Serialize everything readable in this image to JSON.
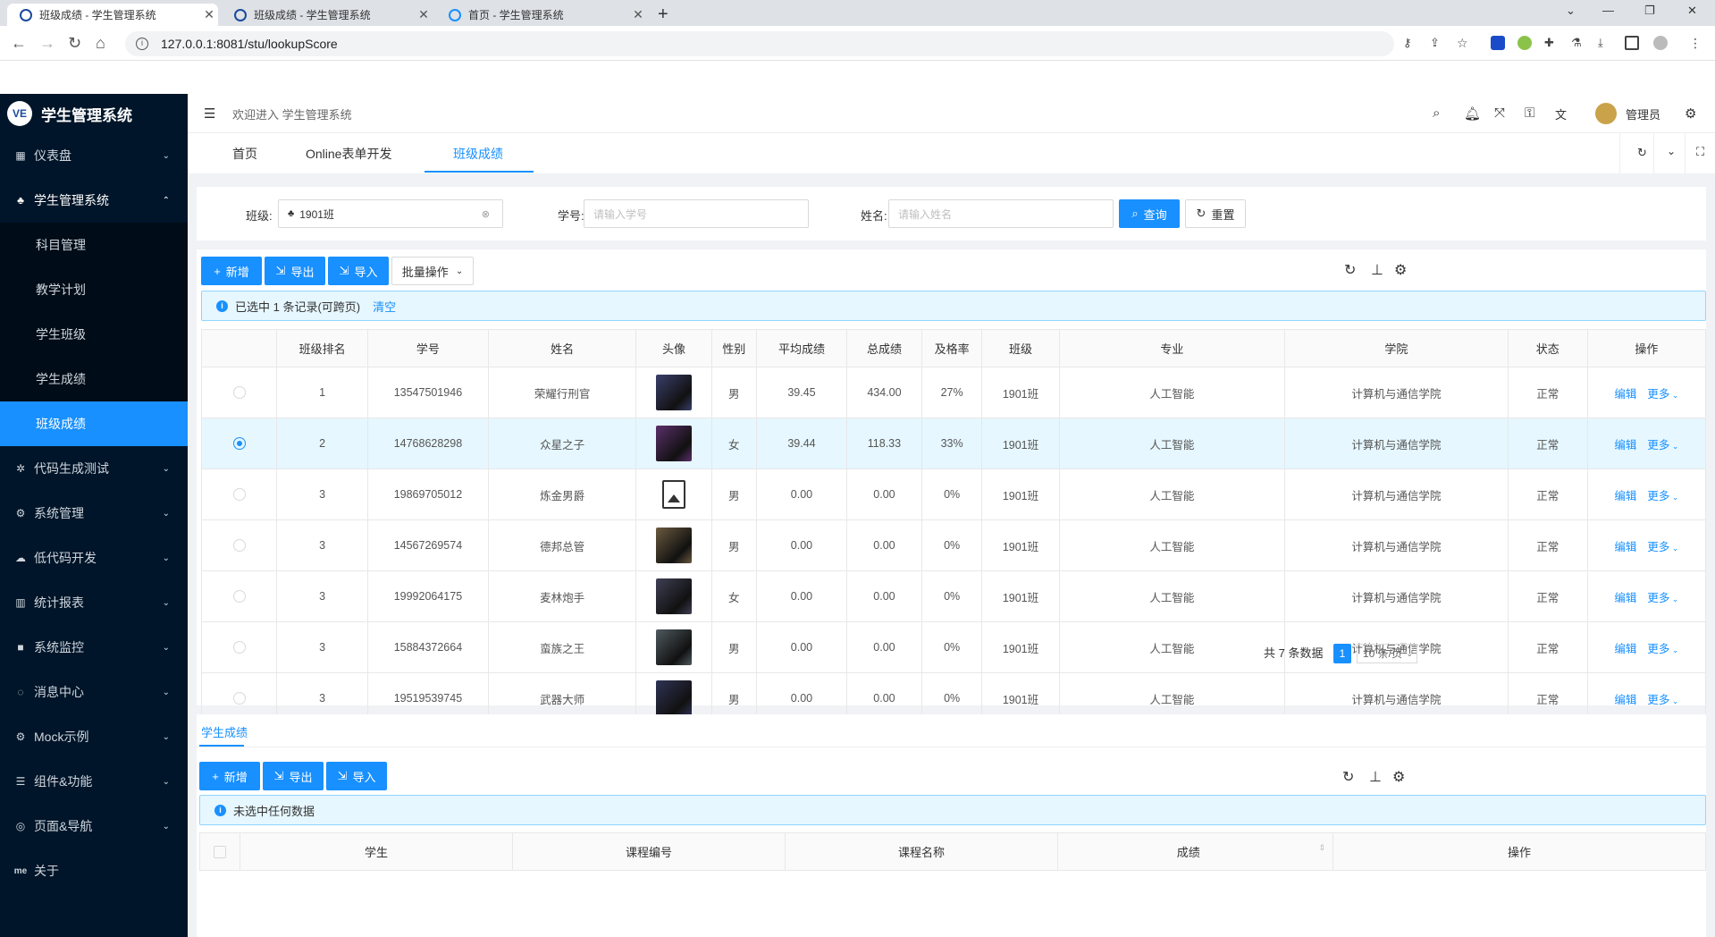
{
  "browser": {
    "tabs": [
      {
        "title": "班级成绩 - 学生管理系统"
      },
      {
        "title": "班级成绩 - 学生管理系统"
      },
      {
        "title": "首页 - 学生管理系统"
      }
    ],
    "url": "127.0.0.1:8081/stu/lookupScore"
  },
  "app": {
    "title": "学生管理系统",
    "welcome": "欢迎进入 学生管理系统",
    "user": "管理员"
  },
  "sidebar": {
    "items": [
      {
        "label": "仪表盘",
        "icon": "dashboard-icon"
      },
      {
        "label": "学生管理系统",
        "icon": "cluster-icon",
        "open": true
      },
      {
        "label": "代码生成测试",
        "icon": "bug-icon"
      },
      {
        "label": "系统管理",
        "icon": "setting-icon"
      },
      {
        "label": "低代码开发",
        "icon": "cloud-icon"
      },
      {
        "label": "统计报表",
        "icon": "bar-chart-icon"
      },
      {
        "label": "系统监控",
        "icon": "video-icon"
      },
      {
        "label": "消息中心",
        "icon": "message-icon"
      },
      {
        "label": "Mock示例",
        "icon": "setting-icon"
      },
      {
        "label": "组件&功能",
        "icon": "database-icon"
      },
      {
        "label": "页面&导航",
        "icon": "compass-icon"
      },
      {
        "label": "关于",
        "icon": "me-icon"
      }
    ],
    "subitems": [
      "科目管理",
      "教学计划",
      "学生班级",
      "学生成绩",
      "班级成绩"
    ]
  },
  "pagetabs": [
    "首页",
    "Online表单开发",
    "班级成绩"
  ],
  "search": {
    "class_label": "班级:",
    "class_value": "1901班",
    "sid_label": "学号:",
    "sid_placeholder": "请输入学号",
    "name_label": "姓名:",
    "name_placeholder": "请输入姓名",
    "query": "查询",
    "reset": "重置"
  },
  "toolbar": {
    "add": "新增",
    "export": "导出",
    "import": "导入",
    "batch": "批量操作"
  },
  "selection": {
    "text": "已选中 1 条记录(可跨页)",
    "clear": "清空"
  },
  "table": {
    "columns": [
      "班级排名",
      "学号",
      "姓名",
      "头像",
      "性别",
      "平均成绩",
      "总成绩",
      "及格率",
      "班级",
      "专业",
      "学院",
      "状态",
      "操作"
    ],
    "edit": "编辑",
    "more": "更多",
    "rows": [
      {
        "rank": "1",
        "sid": "13547501946",
        "name": "荣耀行刑官",
        "gender": "男",
        "avg": "39.45",
        "total": "434.00",
        "pass": "27%",
        "class": "1901班",
        "major": "人工智能",
        "college": "计算机与通信学院",
        "status": "正常",
        "selected": false,
        "avatar": "#3a3f6b"
      },
      {
        "rank": "2",
        "sid": "14768628298",
        "name": "众星之子",
        "gender": "女",
        "avg": "39.44",
        "total": "118.33",
        "pass": "33%",
        "class": "1901班",
        "major": "人工智能",
        "college": "计算机与通信学院",
        "status": "正常",
        "selected": true,
        "avatar": "#5a2f6b"
      },
      {
        "rank": "3",
        "sid": "19869705012",
        "name": "炼金男爵",
        "gender": "男",
        "avg": "0.00",
        "total": "0.00",
        "pass": "0%",
        "class": "1901班",
        "major": "人工智能",
        "college": "计算机与通信学院",
        "status": "正常",
        "selected": false,
        "avatar": "none"
      },
      {
        "rank": "3",
        "sid": "14567269574",
        "name": "德邦总管",
        "gender": "男",
        "avg": "0.00",
        "total": "0.00",
        "pass": "0%",
        "class": "1901班",
        "major": "人工智能",
        "college": "计算机与通信学院",
        "status": "正常",
        "selected": false,
        "avatar": "#6b5a3f"
      },
      {
        "rank": "3",
        "sid": "19992064175",
        "name": "麦林炮手",
        "gender": "女",
        "avg": "0.00",
        "total": "0.00",
        "pass": "0%",
        "class": "1901班",
        "major": "人工智能",
        "college": "计算机与通信学院",
        "status": "正常",
        "selected": false,
        "avatar": "#3f3f55"
      },
      {
        "rank": "3",
        "sid": "15884372664",
        "name": "蛮族之王",
        "gender": "男",
        "avg": "0.00",
        "total": "0.00",
        "pass": "0%",
        "class": "1901班",
        "major": "人工智能",
        "college": "计算机与通信学院",
        "status": "正常",
        "selected": false,
        "avatar": "#4f5a5f"
      },
      {
        "rank": "3",
        "sid": "19519539745",
        "name": "武器大师",
        "gender": "男",
        "avg": "0.00",
        "total": "0.00",
        "pass": "0%",
        "class": "1901班",
        "major": "人工智能",
        "college": "计算机与通信学院",
        "status": "正常",
        "selected": false,
        "avatar": "#2f3355"
      }
    ]
  },
  "pagination": {
    "total": "共 7 条数据",
    "page": "1",
    "size": "10 条/页"
  },
  "subpanel": {
    "tab": "学生成绩",
    "add": "新增",
    "export": "导出",
    "import": "导入",
    "alert": "未选中任何数据",
    "columns": [
      "学生",
      "课程编号",
      "课程名称",
      "成绩",
      "操作"
    ]
  },
  "colors": {
    "primary": "#1890ff",
    "sidebar": "#001529"
  }
}
